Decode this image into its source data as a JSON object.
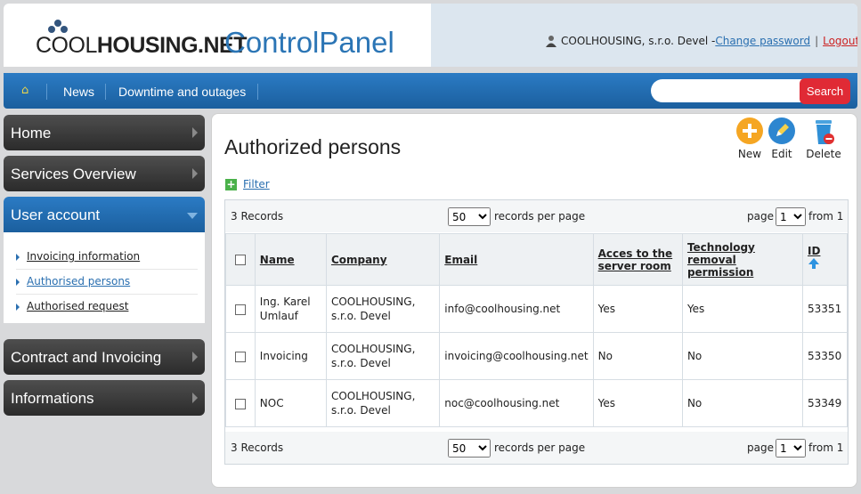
{
  "header": {
    "logo_text_thin": "COOL",
    "logo_text_bold": "HOUSING.NET",
    "app_title": "ControlPanel",
    "user_name": "COOLHOUSING, s.r.o. Devel -",
    "change_password": "Change password",
    "separator": "|",
    "logout": "Logout"
  },
  "nav": {
    "items": [
      "News",
      "Downtime and outages"
    ],
    "search_placeholder": "",
    "search_button": "Search"
  },
  "sidebar": {
    "items": [
      "Home",
      "Services Overview",
      "User account",
      "Contract and Invoicing",
      "Informations"
    ],
    "active_index": 2,
    "submenu": [
      "Invoicing information",
      "Authorised persons",
      "Authorised request"
    ],
    "submenu_current_index": 1
  },
  "main": {
    "title": "Authorized persons",
    "toolbar": {
      "new": "New",
      "edit": "Edit",
      "delete": "Delete"
    },
    "filter_label": "Filter",
    "pager": {
      "record_count": "3 Records",
      "per_page_value": "50",
      "per_page_label": "records per page",
      "page_label": "page",
      "page_value": "1",
      "from_label": "from 1"
    },
    "table": {
      "columns": [
        "Name",
        "Company",
        "Email",
        "Acces to the server room",
        "Technology removal permission",
        "ID"
      ],
      "sort_column": "ID",
      "sort_direction": "up",
      "rows": [
        {
          "name": "Ing. Karel Umlauf",
          "company": "COOLHOUSING, s.r.o. Devel",
          "email": "info@coolhousing.net",
          "server_room": "Yes",
          "removal": "Yes",
          "id": "53351"
        },
        {
          "name": "Invoicing",
          "company": "COOLHOUSING, s.r.o. Devel",
          "email": "invoicing@coolhousing.net",
          "server_room": "No",
          "removal": "No",
          "id": "53350"
        },
        {
          "name": "NOC",
          "company": "COOLHOUSING, s.r.o. Devel",
          "email": "noc@coolhousing.net",
          "server_room": "Yes",
          "removal": "No",
          "id": "53349"
        }
      ]
    }
  },
  "colors": {
    "accent_blue": "#1f6aad",
    "search_red": "#e02a35",
    "sidebar_dark": "#333333",
    "title_blue": "#2b75b5"
  },
  "icons": [
    "user-icon",
    "logout-icon",
    "home-icon",
    "new-icon",
    "edit-icon",
    "delete-icon",
    "filter-plus-icon",
    "sort-up-icon",
    "chevron-right-icon",
    "chevron-down-icon"
  ]
}
